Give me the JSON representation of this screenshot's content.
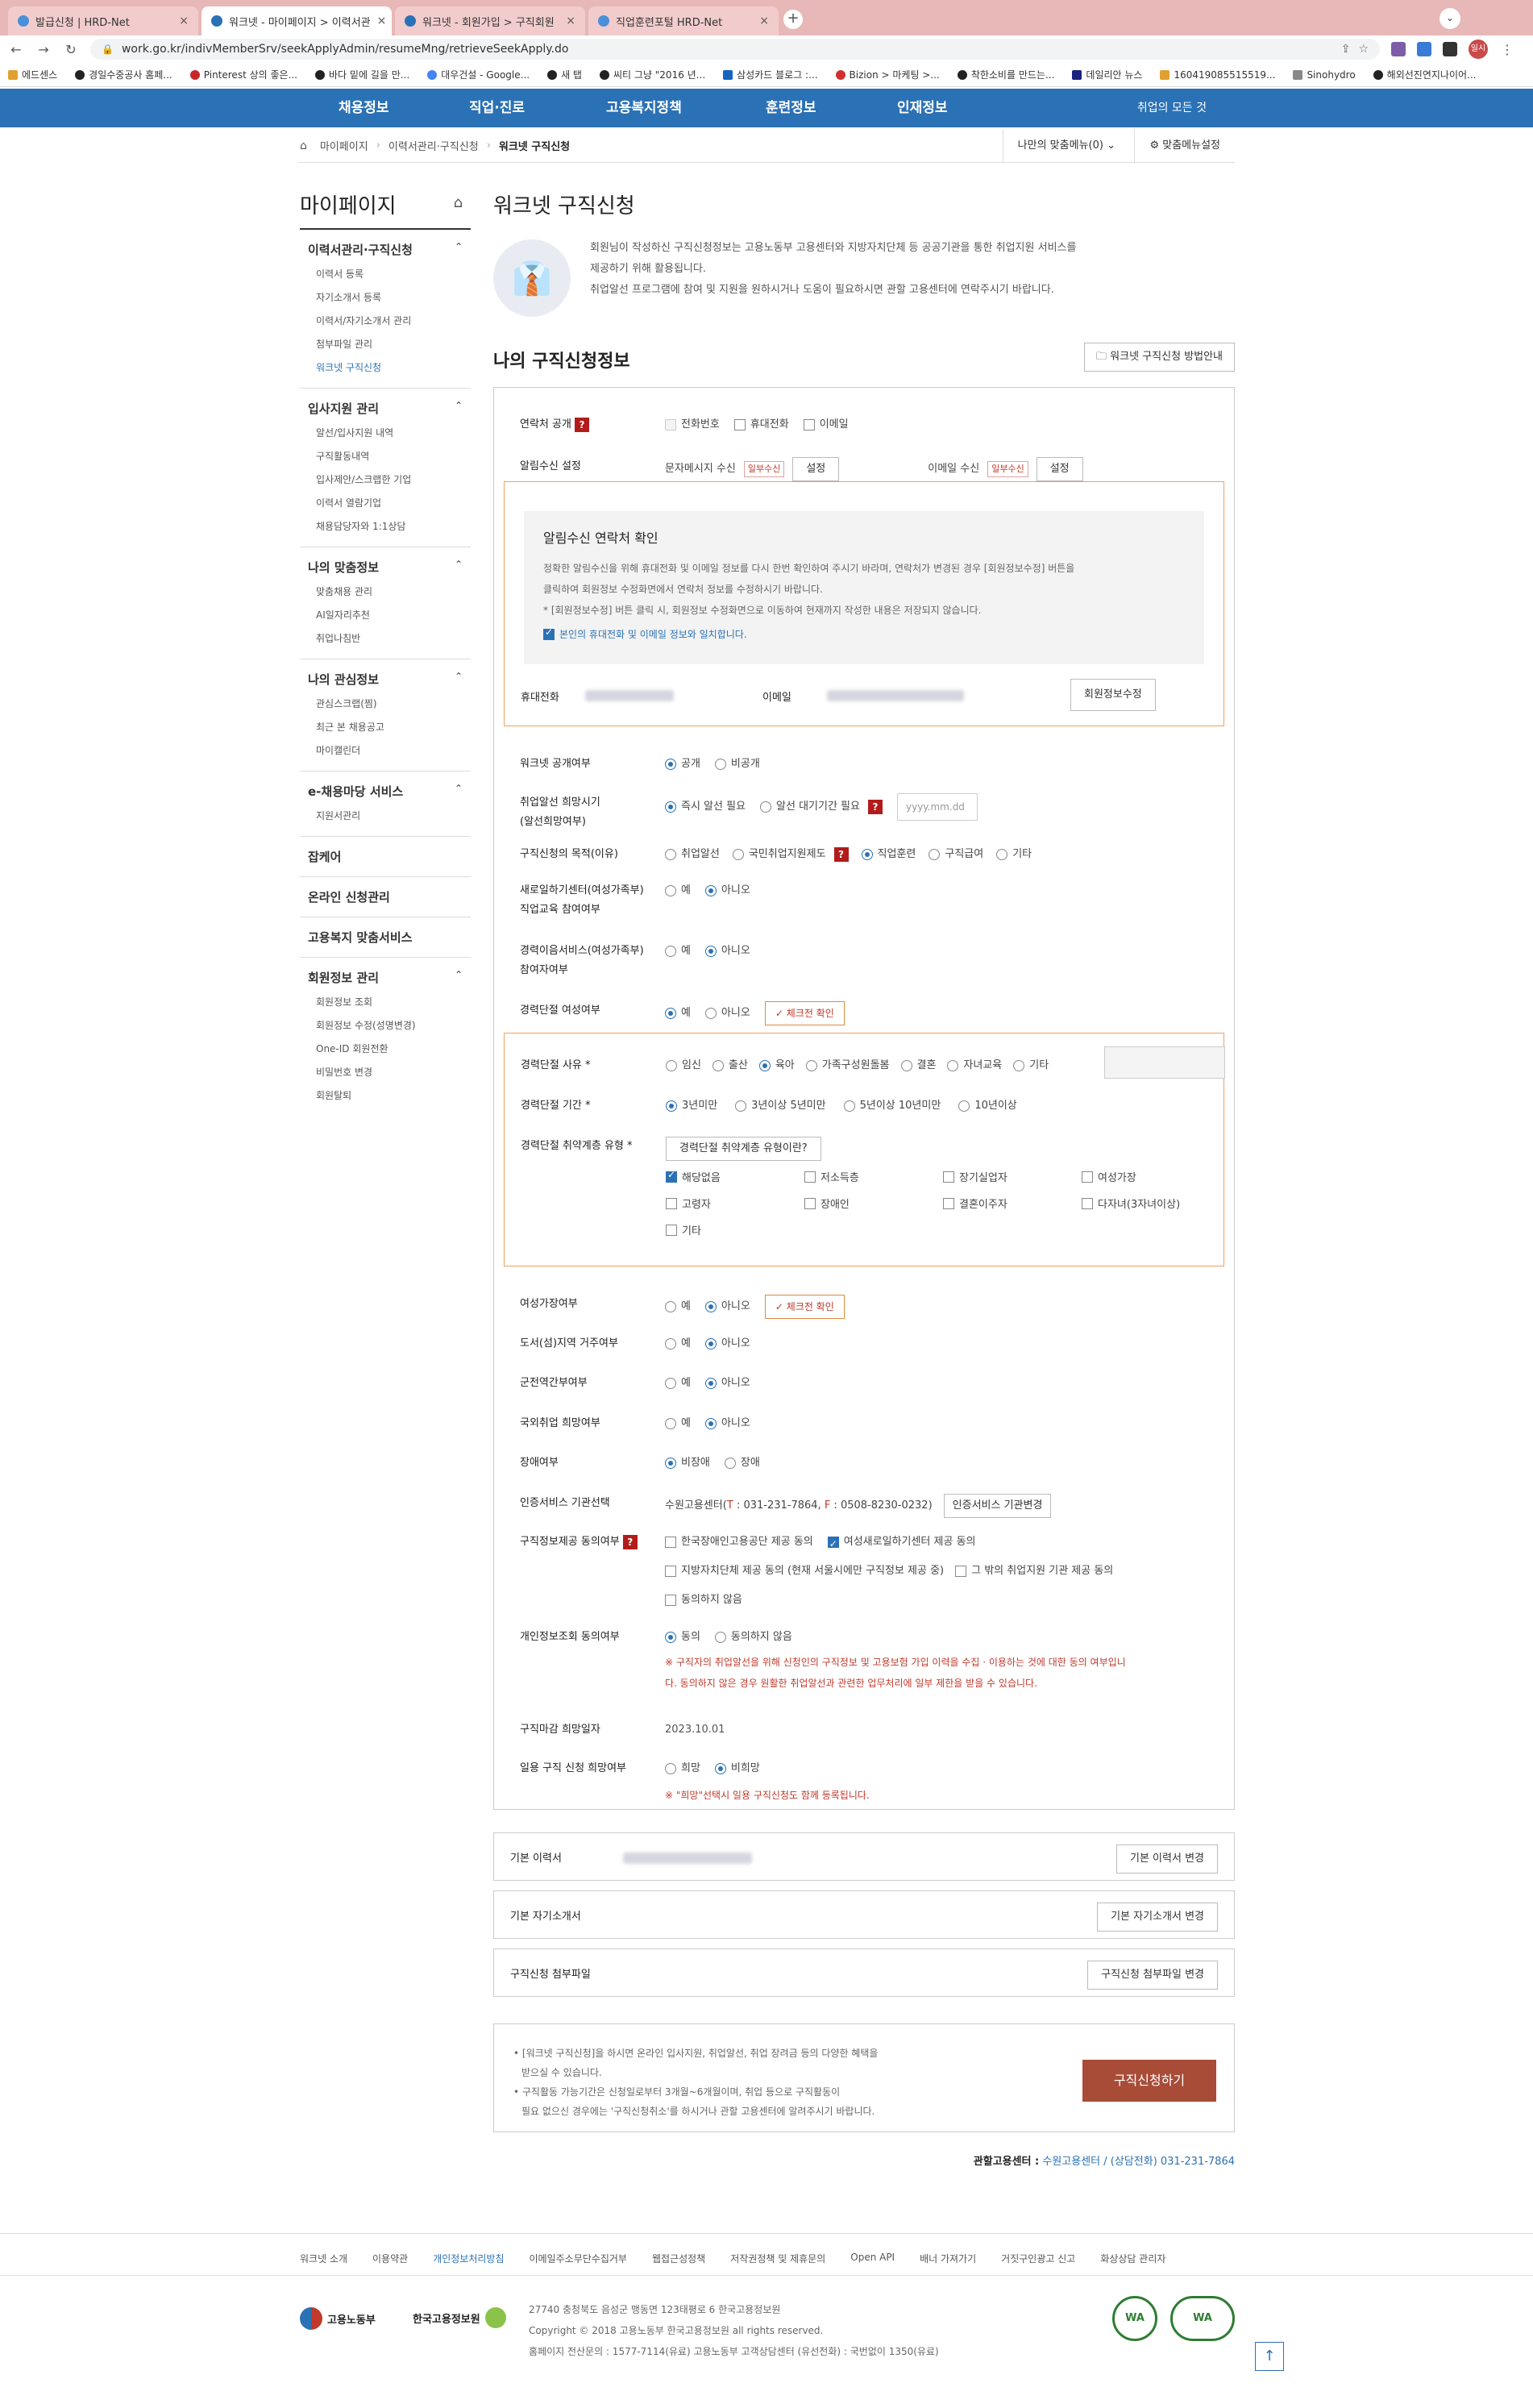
{
  "browser": {
    "tabs": [
      "발급신청 | HRD-Net",
      "워크넷 - 마이페이지 > 이력서관",
      "워크넷 - 회원가입 > 구직회원",
      "직업훈련포털 HRD-Net"
    ],
    "url": "work.go.kr/indivMemberSrv/seekApplyAdmin/resumeMng/retrieveSeekApply.do",
    "avatar": "일시중",
    "bookmarks": [
      "에드센스",
      "경일수중공사 홈페...",
      "Pinterest 상의 좋은...",
      "바다 밑에 길을 만...",
      "대우건설 - Google...",
      "새 탭",
      "씨티 그냥 \"2016 년...",
      "삼성카드 블로그 :...",
      "Bizion > 마케팅 >...",
      "착한소비를 만드는...",
      "데일리안 뉴스",
      "160419085515519...",
      "Sinohydro",
      "해외선진연지나이어..."
    ]
  },
  "gnb": {
    "items": [
      "채용정보",
      "직업·진로",
      "고용복지정책",
      "훈련정보",
      "인재정보"
    ],
    "right": "취업의 모든 것"
  },
  "location": {
    "crumbs": [
      "마이페이지",
      "이력서관리·구직신청",
      "워크넷 구직신청"
    ],
    "my_menu": "나만의 맞춤메뉴(0)",
    "custom_menu": "맞춤메뉴설정"
  },
  "lnb": {
    "title": "마이페이지",
    "groups": [
      {
        "title": "이력서관리·구직신청",
        "links": [
          "이력서 등록",
          "자기소개서 등록",
          "이력서/자기소개서 관리",
          "첨부파일 관리",
          "워크넷 구직신청"
        ]
      },
      {
        "title": "입사지원 관리",
        "links": [
          "알선/입사지원 내역",
          "구직활동내역",
          "입사제안/스크랩한 기업",
          "이력서 열람기업",
          "채용담당자와 1:1상담"
        ]
      },
      {
        "title": "나의 맞춤정보",
        "links": [
          "맞춤채용 관리",
          "AI일자리추천",
          "취업나침반"
        ]
      },
      {
        "title": "나의 관심정보",
        "links": [
          "관심스크랩(찜)",
          "최근 본 채용공고",
          "마이캘린더"
        ]
      },
      {
        "title": "e-채용마당 서비스",
        "links": [
          "지원서관리"
        ]
      }
    ],
    "singles": [
      "잡케어",
      "온라인 신청관리",
      "고용복지 맞춤서비스"
    ],
    "member": {
      "title": "회원정보 관리",
      "links": [
        "회원정보 조회",
        "회원정보 수정(성명변경)",
        "One-ID 회원전환",
        "비밀번호 변경",
        "회원탈퇴"
      ]
    }
  },
  "main": {
    "title": "워크넷 구직신청",
    "intro": [
      "회원님이 작성하신 구직신청정보는 고용노동부 고용센터와 지방자치단체 등 공공기관을 통한 취업지원 서비스를",
      "제공하기 위해 활용됩니다.",
      "취업알선 프로그램에 참여 및 지원을 원하시거나 도움이 필요하시면 관할 고용센터에 연락주시기 바랍니다."
    ],
    "section_title": "나의 구직신청정보",
    "guide_button": "워크넷 구직신청 방법안내"
  },
  "form": {
    "contact_public": {
      "label": "연락처 공개",
      "options": [
        "전화번호",
        "휴대전화",
        "이메일"
      ]
    },
    "notify": {
      "label": "알림수신 설정",
      "sms_label": "문자메시지 수신",
      "sms_tag": "일부수신",
      "email_label": "이메일 수신",
      "email_tag": "일부수신",
      "set_btn": "설정"
    },
    "confirm": {
      "title": "알림수신 연락처 확인",
      "lines": [
        "정확한 알림수신을 위해 휴대전화 및 이메일 정보를 다시 한번 확인하여 주시기 바라며, 연락처가 변경된 경우 [회원정보수정] 버튼을",
        "클릭하여 회원정보 수정화면에서 연락처 정보를 수정하시기 바랍니다.",
        "* [회원정보수정] 버튼 클릭 시, 회원정보 수정화면으로 이동하여 현재까지 작성한 내용은 저장되지 않습니다."
      ],
      "agree": "본인의 휴대전화 및 이메일 정보와 일치합니다.",
      "phone_label": "휴대전화",
      "email_label": "이메일",
      "edit_btn": "회원정보수정"
    },
    "worknet_public": {
      "label": "워크넷 공개여부",
      "options": [
        "공개",
        "비공개"
      ]
    },
    "placement_time": {
      "label": [
        "취업알선 희망시기",
        "(알선희망여부)"
      ],
      "options": [
        "즉시 알선 필요",
        "알선 대기기간 필요"
      ],
      "date_placeholder": "yyyy.mm.dd"
    },
    "purpose": {
      "label": "구직신청의 목적(이유)",
      "options": [
        "취업알선",
        "국민취업지원제도",
        "직업훈련",
        "구직급여",
        "기타"
      ]
    },
    "new_center": {
      "label": [
        "새로일하기센터(여성가족부)",
        "직업교육 참여여부"
      ],
      "options": [
        "예",
        "아니오"
      ]
    },
    "career_service": {
      "label": [
        "경력이음서비스(여성가족부)",
        "참여자여부"
      ],
      "options": [
        "예",
        "아니오"
      ]
    },
    "career_break": {
      "label": "경력단절 여성여부",
      "options": [
        "예",
        "아니오"
      ],
      "check_btn": "체크전 확인"
    },
    "break_reason": {
      "label": "경력단절 사유 *",
      "options": [
        "임신",
        "출산",
        "육아",
        "가족구성원돌봄",
        "결혼",
        "자녀교육",
        "기타"
      ]
    },
    "break_period": {
      "label": "경력단절 기간 *",
      "options": [
        "3년미만",
        "3년이상 5년미만",
        "5년이상 10년미만",
        "10년이상"
      ]
    },
    "vuln_type": {
      "label": "경력단절 취약계층 유형 *",
      "btn": "경력단절 취약계층 유형이란?",
      "options": [
        "해당없음",
        "저소득층",
        "장기실업자",
        "여성가장",
        "고령자",
        "장애인",
        "결혼이주자",
        "다자녀(3자녀이상)",
        "기타"
      ]
    },
    "female_head": {
      "label": "여성가장여부",
      "options": [
        "예",
        "아니오"
      ],
      "check_btn": "체크전 확인"
    },
    "island": {
      "label": "도서(섬)지역 거주여부",
      "options": [
        "예",
        "아니오"
      ]
    },
    "military": {
      "label": "군전역간부여부",
      "options": [
        "예",
        "아니오"
      ]
    },
    "overseas": {
      "label": "국외취업 희망여부",
      "options": [
        "예",
        "아니오"
      ]
    },
    "disability": {
      "label": "장애여부",
      "options": [
        "비장애",
        "장애"
      ]
    },
    "cert_agency": {
      "label": "인증서비스 기관선택",
      "value_prefix": "수원고용센터(",
      "t_label": "T",
      "t_value": " : 031-231-7864, ",
      "f_label": "F",
      "f_value": " : 0508-8230-0232)",
      "btn": "인증서비스 기관변경"
    },
    "consent": {
      "label": "구직정보제공 동의여부",
      "options": [
        "한국장애인고용공단 제공 동의",
        "여성새로일하기센터 제공 동의",
        "지방자치단체 제공 동의 (현재 서울시에만 구직정보 제공 중)",
        "그 밖의 취업지원 기관 제공 동의",
        "동의하지 않음"
      ]
    },
    "privacy": {
      "label": "개인정보조회 동의여부",
      "options": [
        "동의",
        "동의하지 않음"
      ],
      "notes": [
        "※ 구직자의 취업알선을 위해 신청인의 구직정보 및 고용보험 가입 이력을 수집 · 이용하는 것에 대한 동의 여부입니",
        "다. 동의하지 않은 경우 원활한 취업알선과 관련한 업무처리에 일부 제한을 받을 수 있습니다."
      ]
    },
    "deadline": {
      "label": "구직마감 희망일자",
      "value": "2023.10.01"
    },
    "daily": {
      "label": "일용 구직 신청 희망여부",
      "options": [
        "희망",
        "비희망"
      ],
      "note": "※ \"희망\"선택시 일용 구직신청도 함께 등록됩니다."
    }
  },
  "info_rows": [
    {
      "label": "기본 이력서",
      "btn": "기본 이력서 변경"
    },
    {
      "label": "기본 자기소개서",
      "btn": "기본 자기소개서 변경"
    },
    {
      "label": "구직신청 첨부파일",
      "btn": "구직신청 첨부파일 변경"
    }
  ],
  "bottom": {
    "notes": [
      "• [워크넷 구직신청]을 하시면 온라인 입사지원, 취업알선, 취업 장려금 등의 다양한 혜택을",
      "  받으실 수 있습니다.",
      "• 구직활동 가능기간은 신청일로부터 3개월~6개월이며, 취업 등으로 구직활동이",
      "  필요 없으신 경우에는 '구직신청취소'를 하시거나 관할 고용센터에 알려주시기 바랍니다."
    ],
    "submit": "구직신청하기",
    "office_label": "관할고용센터 :",
    "office_link": "수원고용센터 / (상담전화) 031-231-7864"
  },
  "footer": {
    "links": [
      "워크넷 소개",
      "이용약관",
      "개인정보처리방침",
      "이메일주소무단수집거부",
      "웹접근성정책",
      "저작권정책 및 제휴문의",
      "Open API",
      "배너 가져가기",
      "거짓구인광고 신고",
      "화상상담 관리자"
    ],
    "org1": "고용노동부",
    "org2": "한국고용정보원",
    "addr": [
      "27740 충청북도 음성군 맹동면 123태평로 6 한국고용정보원",
      "Copyright © 2018 고용노동부 한국고용정보원 all rights reserved.",
      "홈페이지 전산문의 : 1577-7114(유료)     고용노동부 고객상담센터 (유선전화) : 국번없이 1350(유료)"
    ],
    "badge1": "WA",
    "badge2": "WA"
  }
}
